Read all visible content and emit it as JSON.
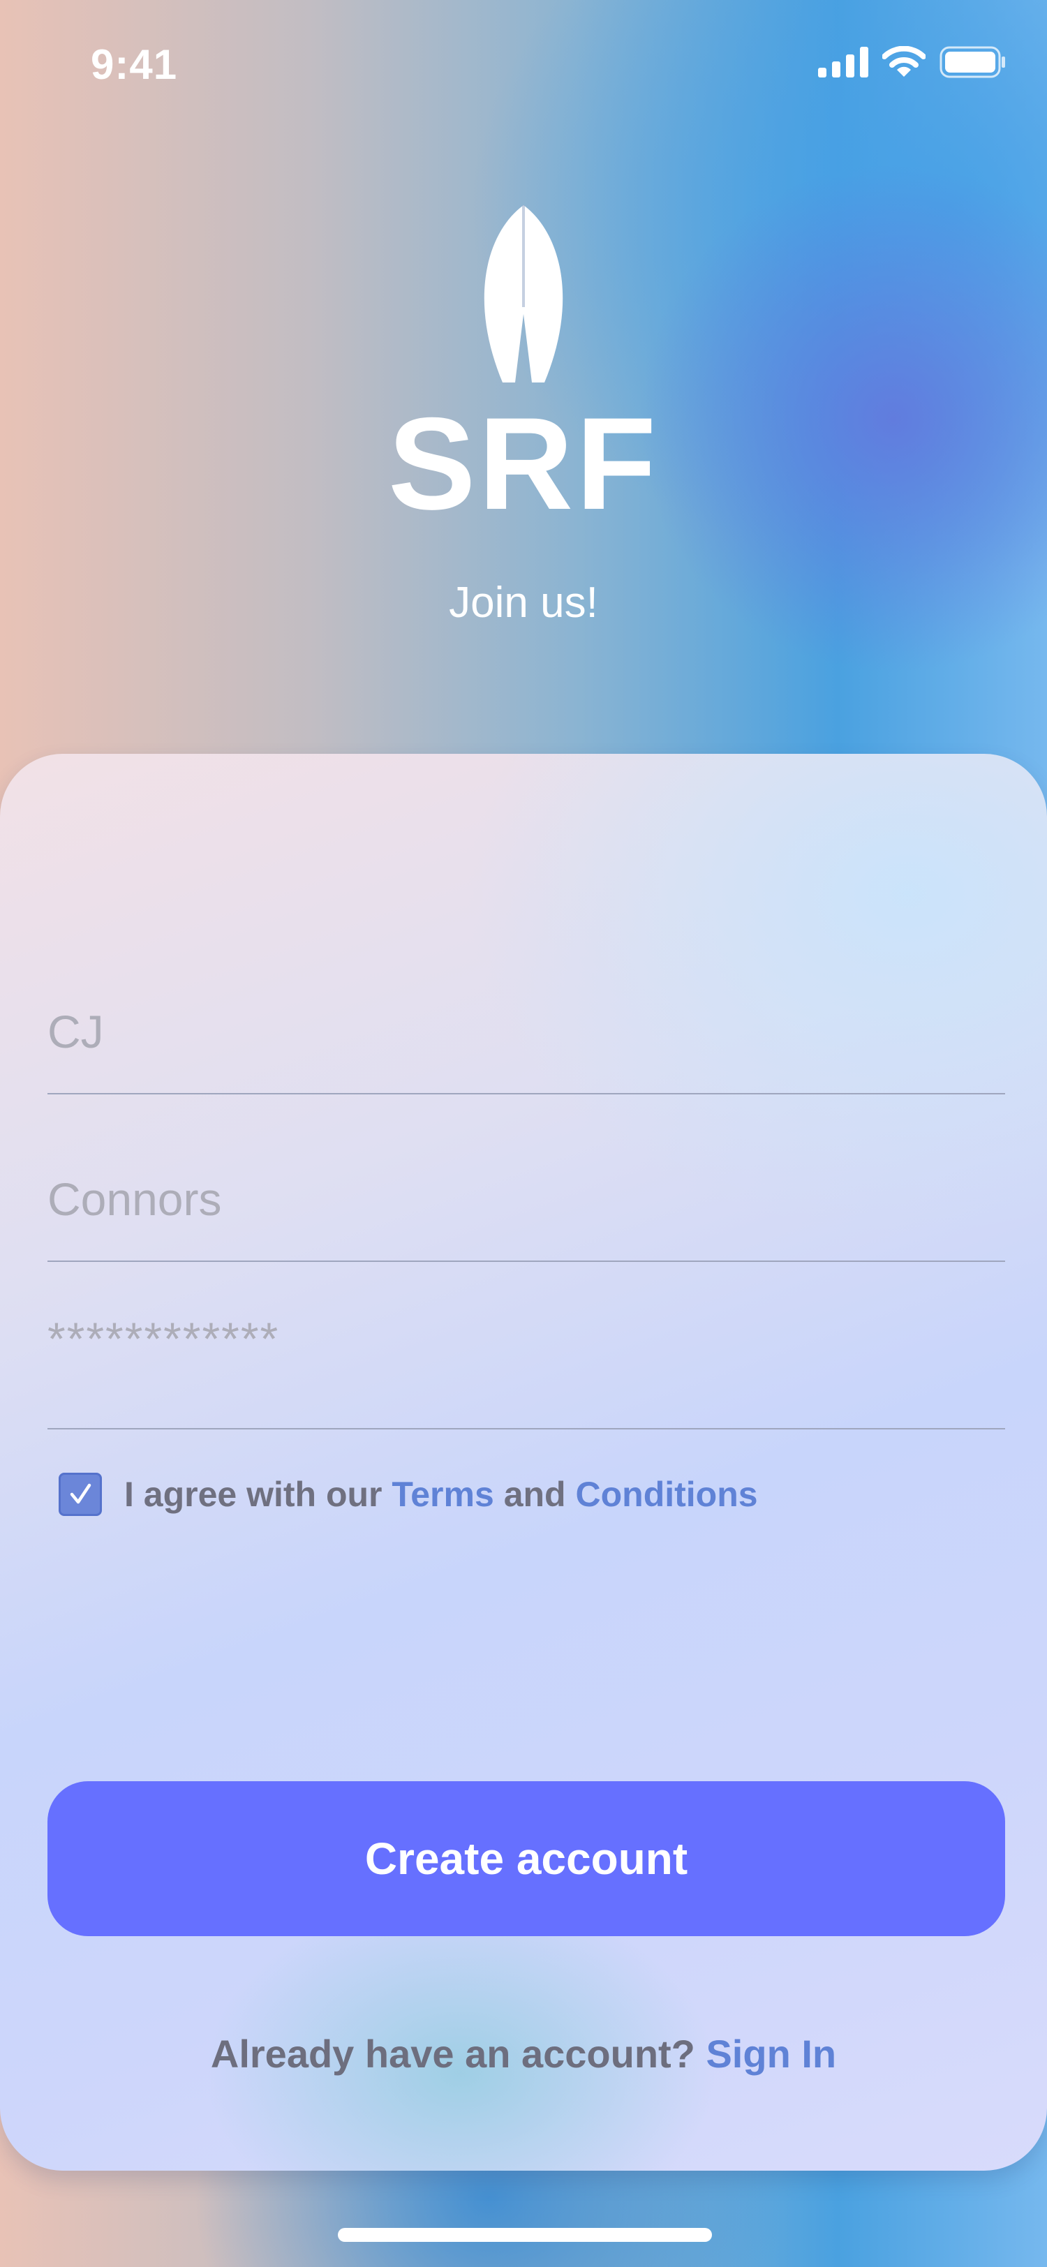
{
  "status_bar": {
    "time": "9:41",
    "icons": [
      "cellular-signal-icon",
      "wifi-icon",
      "battery-icon"
    ]
  },
  "brand": {
    "logo_icon": "leaf-icon",
    "name": "SRF",
    "tagline": "Join us!"
  },
  "form": {
    "first_name": {
      "value": "CJ"
    },
    "last_name": {
      "value": "Connors"
    },
    "password": {
      "value": "************"
    },
    "agree": {
      "checked": true,
      "prefix": "I agree with our",
      "terms_link": "Terms",
      "conjunction": "and",
      "conditions_link": "Conditions"
    },
    "submit_label": "Create account",
    "signin_prompt": "Already have an account?",
    "signin_link": "Sign In"
  },
  "colors": {
    "primary_button": "#6670ff",
    "link": "#5f82d6",
    "checkbox": "#6b86d9"
  }
}
